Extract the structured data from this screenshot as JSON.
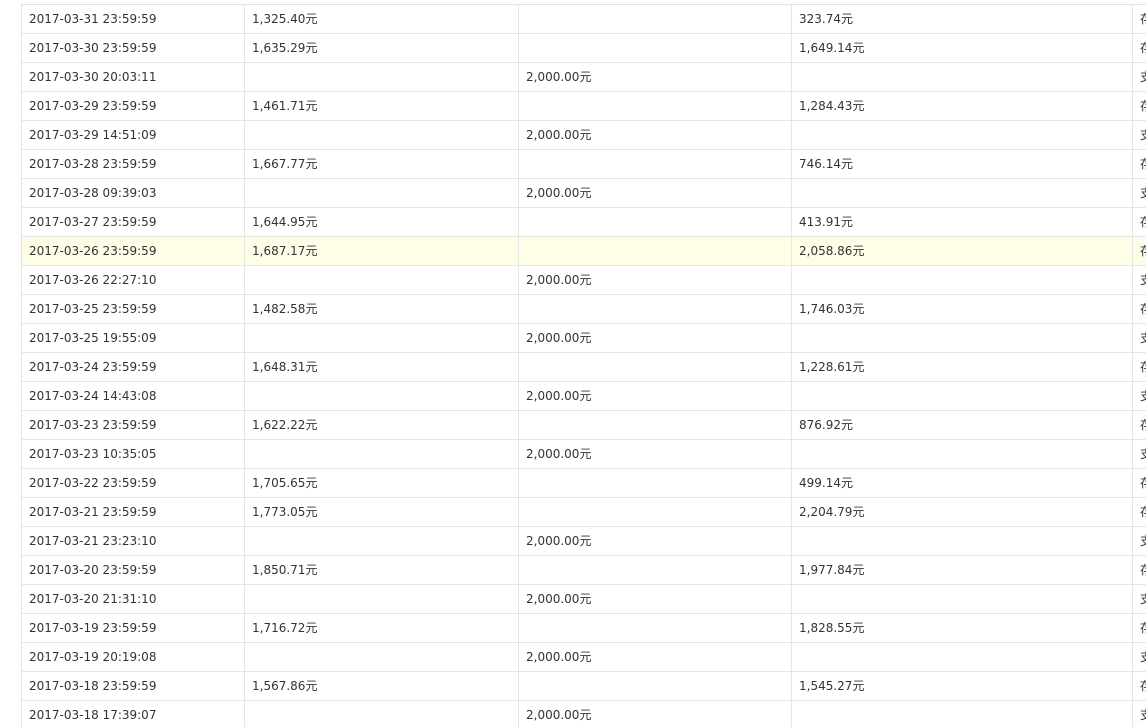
{
  "currency_suffix": "元",
  "rows": [
    {
      "time": "2017-03-31 23:59:59",
      "income": "1,325.40元",
      "expense": "",
      "balance": "323.74元",
      "type": "存"
    },
    {
      "time": "2017-03-30 23:59:59",
      "income": "1,635.29元",
      "expense": "",
      "balance": "1,649.14元",
      "type": "存"
    },
    {
      "time": "2017-03-30 20:03:11",
      "income": "",
      "expense": "2,000.00元",
      "balance": "",
      "type": "支"
    },
    {
      "time": "2017-03-29 23:59:59",
      "income": "1,461.71元",
      "expense": "",
      "balance": "1,284.43元",
      "type": "存"
    },
    {
      "time": "2017-03-29 14:51:09",
      "income": "",
      "expense": "2,000.00元",
      "balance": "",
      "type": "支"
    },
    {
      "time": "2017-03-28 23:59:59",
      "income": "1,667.77元",
      "expense": "",
      "balance": "746.14元",
      "type": "存"
    },
    {
      "time": "2017-03-28 09:39:03",
      "income": "",
      "expense": "2,000.00元",
      "balance": "",
      "type": "支"
    },
    {
      "time": "2017-03-27 23:59:59",
      "income": "1,644.95元",
      "expense": "",
      "balance": "413.91元",
      "type": "存"
    },
    {
      "time": "2017-03-26 23:59:59",
      "income": "1,687.17元",
      "expense": "",
      "balance": "2,058.86元",
      "type": "存",
      "highlighted": true
    },
    {
      "time": "2017-03-26 22:27:10",
      "income": "",
      "expense": "2,000.00元",
      "balance": "",
      "type": "支"
    },
    {
      "time": "2017-03-25 23:59:59",
      "income": "1,482.58元",
      "expense": "",
      "balance": "1,746.03元",
      "type": "存"
    },
    {
      "time": "2017-03-25 19:55:09",
      "income": "",
      "expense": "2,000.00元",
      "balance": "",
      "type": "支"
    },
    {
      "time": "2017-03-24 23:59:59",
      "income": "1,648.31元",
      "expense": "",
      "balance": "1,228.61元",
      "type": "存"
    },
    {
      "time": "2017-03-24 14:43:08",
      "income": "",
      "expense": "2,000.00元",
      "balance": "",
      "type": "支"
    },
    {
      "time": "2017-03-23 23:59:59",
      "income": "1,622.22元",
      "expense": "",
      "balance": "876.92元",
      "type": "存"
    },
    {
      "time": "2017-03-23 10:35:05",
      "income": "",
      "expense": "2,000.00元",
      "balance": "",
      "type": "支"
    },
    {
      "time": "2017-03-22 23:59:59",
      "income": "1,705.65元",
      "expense": "",
      "balance": "499.14元",
      "type": "存"
    },
    {
      "time": "2017-03-21 23:59:59",
      "income": "1,773.05元",
      "expense": "",
      "balance": "2,204.79元",
      "type": "存"
    },
    {
      "time": "2017-03-21 23:23:10",
      "income": "",
      "expense": "2,000.00元",
      "balance": "",
      "type": "支"
    },
    {
      "time": "2017-03-20 23:59:59",
      "income": "1,850.71元",
      "expense": "",
      "balance": "1,977.84元",
      "type": "存"
    },
    {
      "time": "2017-03-20 21:31:10",
      "income": "",
      "expense": "2,000.00元",
      "balance": "",
      "type": "支"
    },
    {
      "time": "2017-03-19 23:59:59",
      "income": "1,716.72元",
      "expense": "",
      "balance": "1,828.55元",
      "type": "存"
    },
    {
      "time": "2017-03-19 20:19:08",
      "income": "",
      "expense": "2,000.00元",
      "balance": "",
      "type": "支"
    },
    {
      "time": "2017-03-18 23:59:59",
      "income": "1,567.86元",
      "expense": "",
      "balance": "1,545.27元",
      "type": "存"
    },
    {
      "time": "2017-03-18 17:39:07",
      "income": "",
      "expense": "2,000.00元",
      "balance": "",
      "type": "支"
    }
  ]
}
